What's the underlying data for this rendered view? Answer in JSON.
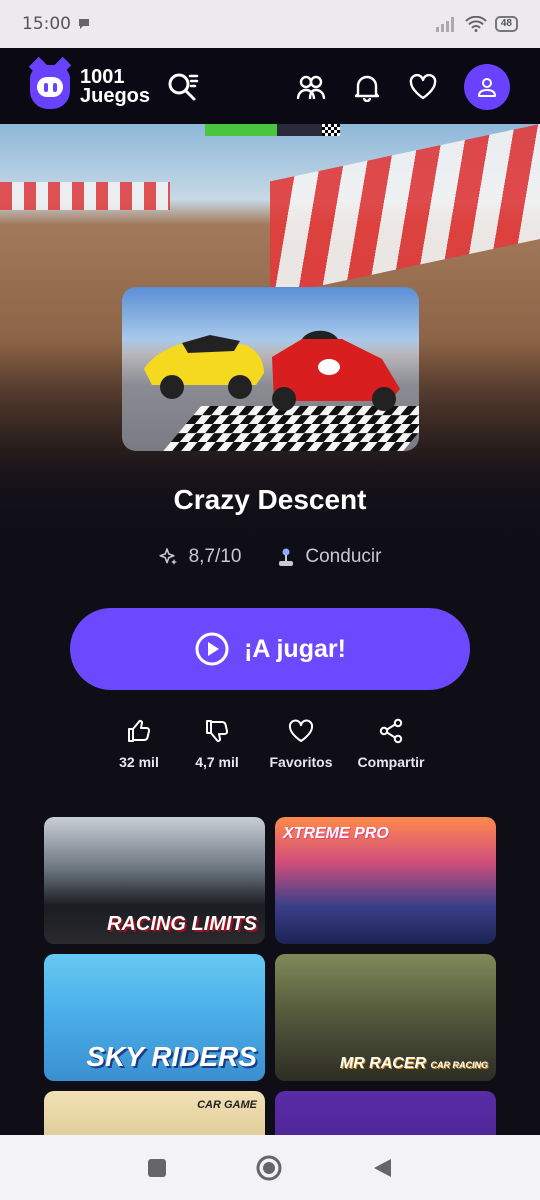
{
  "status_bar": {
    "time": "15:00",
    "battery": "48"
  },
  "app_bar": {
    "logo_line1": "1001",
    "logo_line2": "Juegos"
  },
  "hero": {
    "progress_fraction": 0.53
  },
  "game": {
    "title": "Crazy Descent",
    "rating": "8,7/10",
    "category": "Conducir",
    "play_label": "¡A jugar!"
  },
  "actions": [
    {
      "label": "32 mil",
      "icon": "thumbs-up-icon"
    },
    {
      "label": "4,7 mil",
      "icon": "thumbs-down-icon"
    },
    {
      "label": "Favoritos",
      "icon": "heart-icon"
    },
    {
      "label": "Compartir",
      "icon": "share-icon"
    }
  ],
  "related_games": [
    {
      "label_a": "RACING",
      "label_b": "LIMITS"
    },
    {
      "label_a": "XTREME",
      "label_b": "PRO"
    },
    {
      "label_a": "SKY",
      "label_b": "RIDERS"
    },
    {
      "label_a": "MR RACER",
      "label_b": "CAR RACING"
    },
    {
      "label_a": "CAR GAME",
      "label_b": ""
    },
    {
      "label_a": "",
      "label_b": ""
    }
  ],
  "colors": {
    "accent": "#6c48ff",
    "background": "#0f0e17",
    "appbar": "#0b0a14"
  }
}
